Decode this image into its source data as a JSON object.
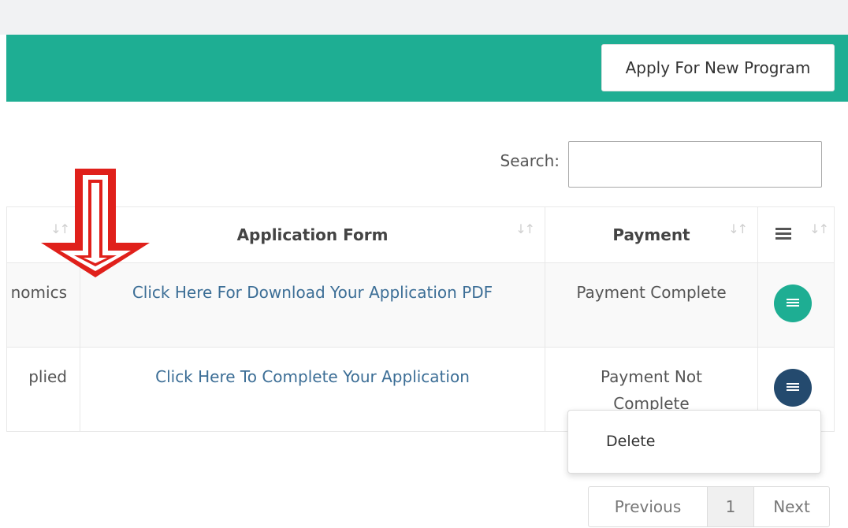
{
  "header": {
    "apply_button_label": "Apply For New Program",
    "bar_color": "#1eae93"
  },
  "search": {
    "label": "Search:",
    "value": "",
    "placeholder": ""
  },
  "table": {
    "columns": [
      {
        "label": ""
      },
      {
        "label": "Application Form"
      },
      {
        "label": "Payment"
      },
      {
        "label": ""
      }
    ],
    "rows": [
      {
        "col0": "nomics",
        "link": "Click Here For Download Your Application PDF",
        "payment": "Payment Complete",
        "action_color": "#1eae93"
      },
      {
        "col0": "plied",
        "link": "Click Here To Complete Your Application",
        "payment": "Payment Not Complete",
        "action_color": "#244a6e"
      }
    ]
  },
  "dropdown": {
    "items": [
      "Delete"
    ]
  },
  "pagination": {
    "previous": "Previous",
    "current_page": "1",
    "next": "Next"
  },
  "annotation": {
    "arrow_color": "#e0201b",
    "icon": "down-arrow-icon"
  }
}
